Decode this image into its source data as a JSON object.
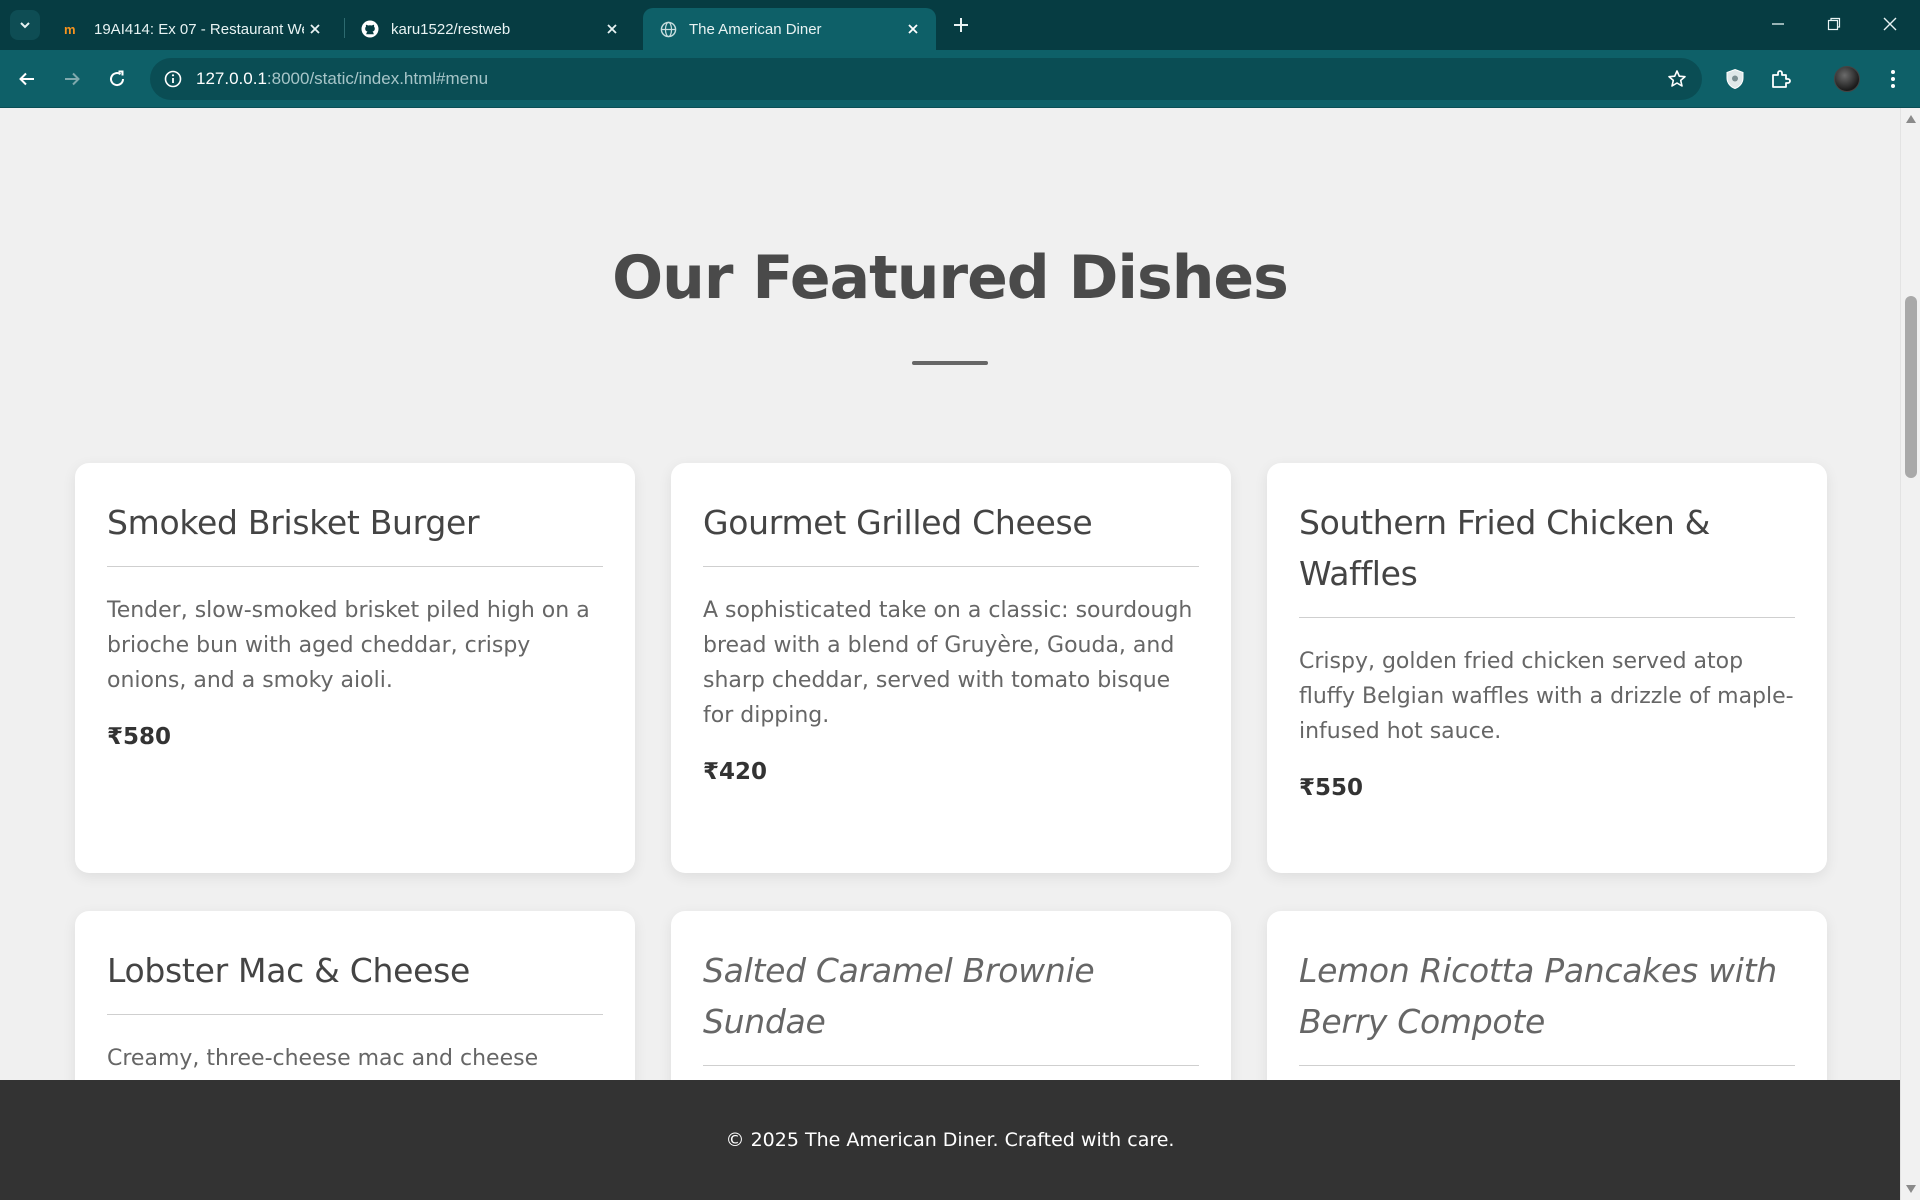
{
  "browser": {
    "tabs": [
      {
        "title": "19AI414: Ex 07 - Restaurant Web",
        "favicon": "moodle-favicon-icon",
        "active": false
      },
      {
        "title": "karu1522/restweb",
        "favicon": "github-icon",
        "active": false
      },
      {
        "title": "The American Diner",
        "favicon": "globe-icon",
        "active": true
      }
    ],
    "url_host": "127.0.0.1",
    "url_rest": ":8000/static/index.html#menu",
    "colors": {
      "tabbar": "#063c42",
      "toolbar": "#0e6068",
      "active_tab": "#0e6068"
    }
  },
  "page": {
    "section_title": "Our Featured Dishes",
    "dishes": [
      {
        "name": "Smoked Brisket Burger",
        "description": "Tender, slow-smoked brisket piled high on a brioche bun with aged cheddar, crispy onions, and a smoky aioli.",
        "price": "₹580"
      },
      {
        "name": "Gourmet Grilled Cheese",
        "description": "A sophisticated take on a classic: sourdough bread with a blend of Gruyère, Gouda, and sharp cheddar, served with tomato bisque for dipping.",
        "price": "₹420"
      },
      {
        "name": "Southern Fried Chicken & Waffles",
        "description": "Crispy, golden fried chicken served atop fluffy Belgian waffles with a drizzle of maple-infused hot sauce.",
        "price": "₹550"
      },
      {
        "name": "Lobster Mac & Cheese",
        "description": "Creamy, three-cheese mac and cheese",
        "price": ""
      },
      {
        "name": "Salted Caramel Brownie Sundae",
        "description": "",
        "price": ""
      },
      {
        "name": "Lemon Ricotta Pancakes with Berry Compote",
        "description": "",
        "price": ""
      }
    ],
    "footer_text": "© 2025 The American Diner. Crafted with care."
  }
}
